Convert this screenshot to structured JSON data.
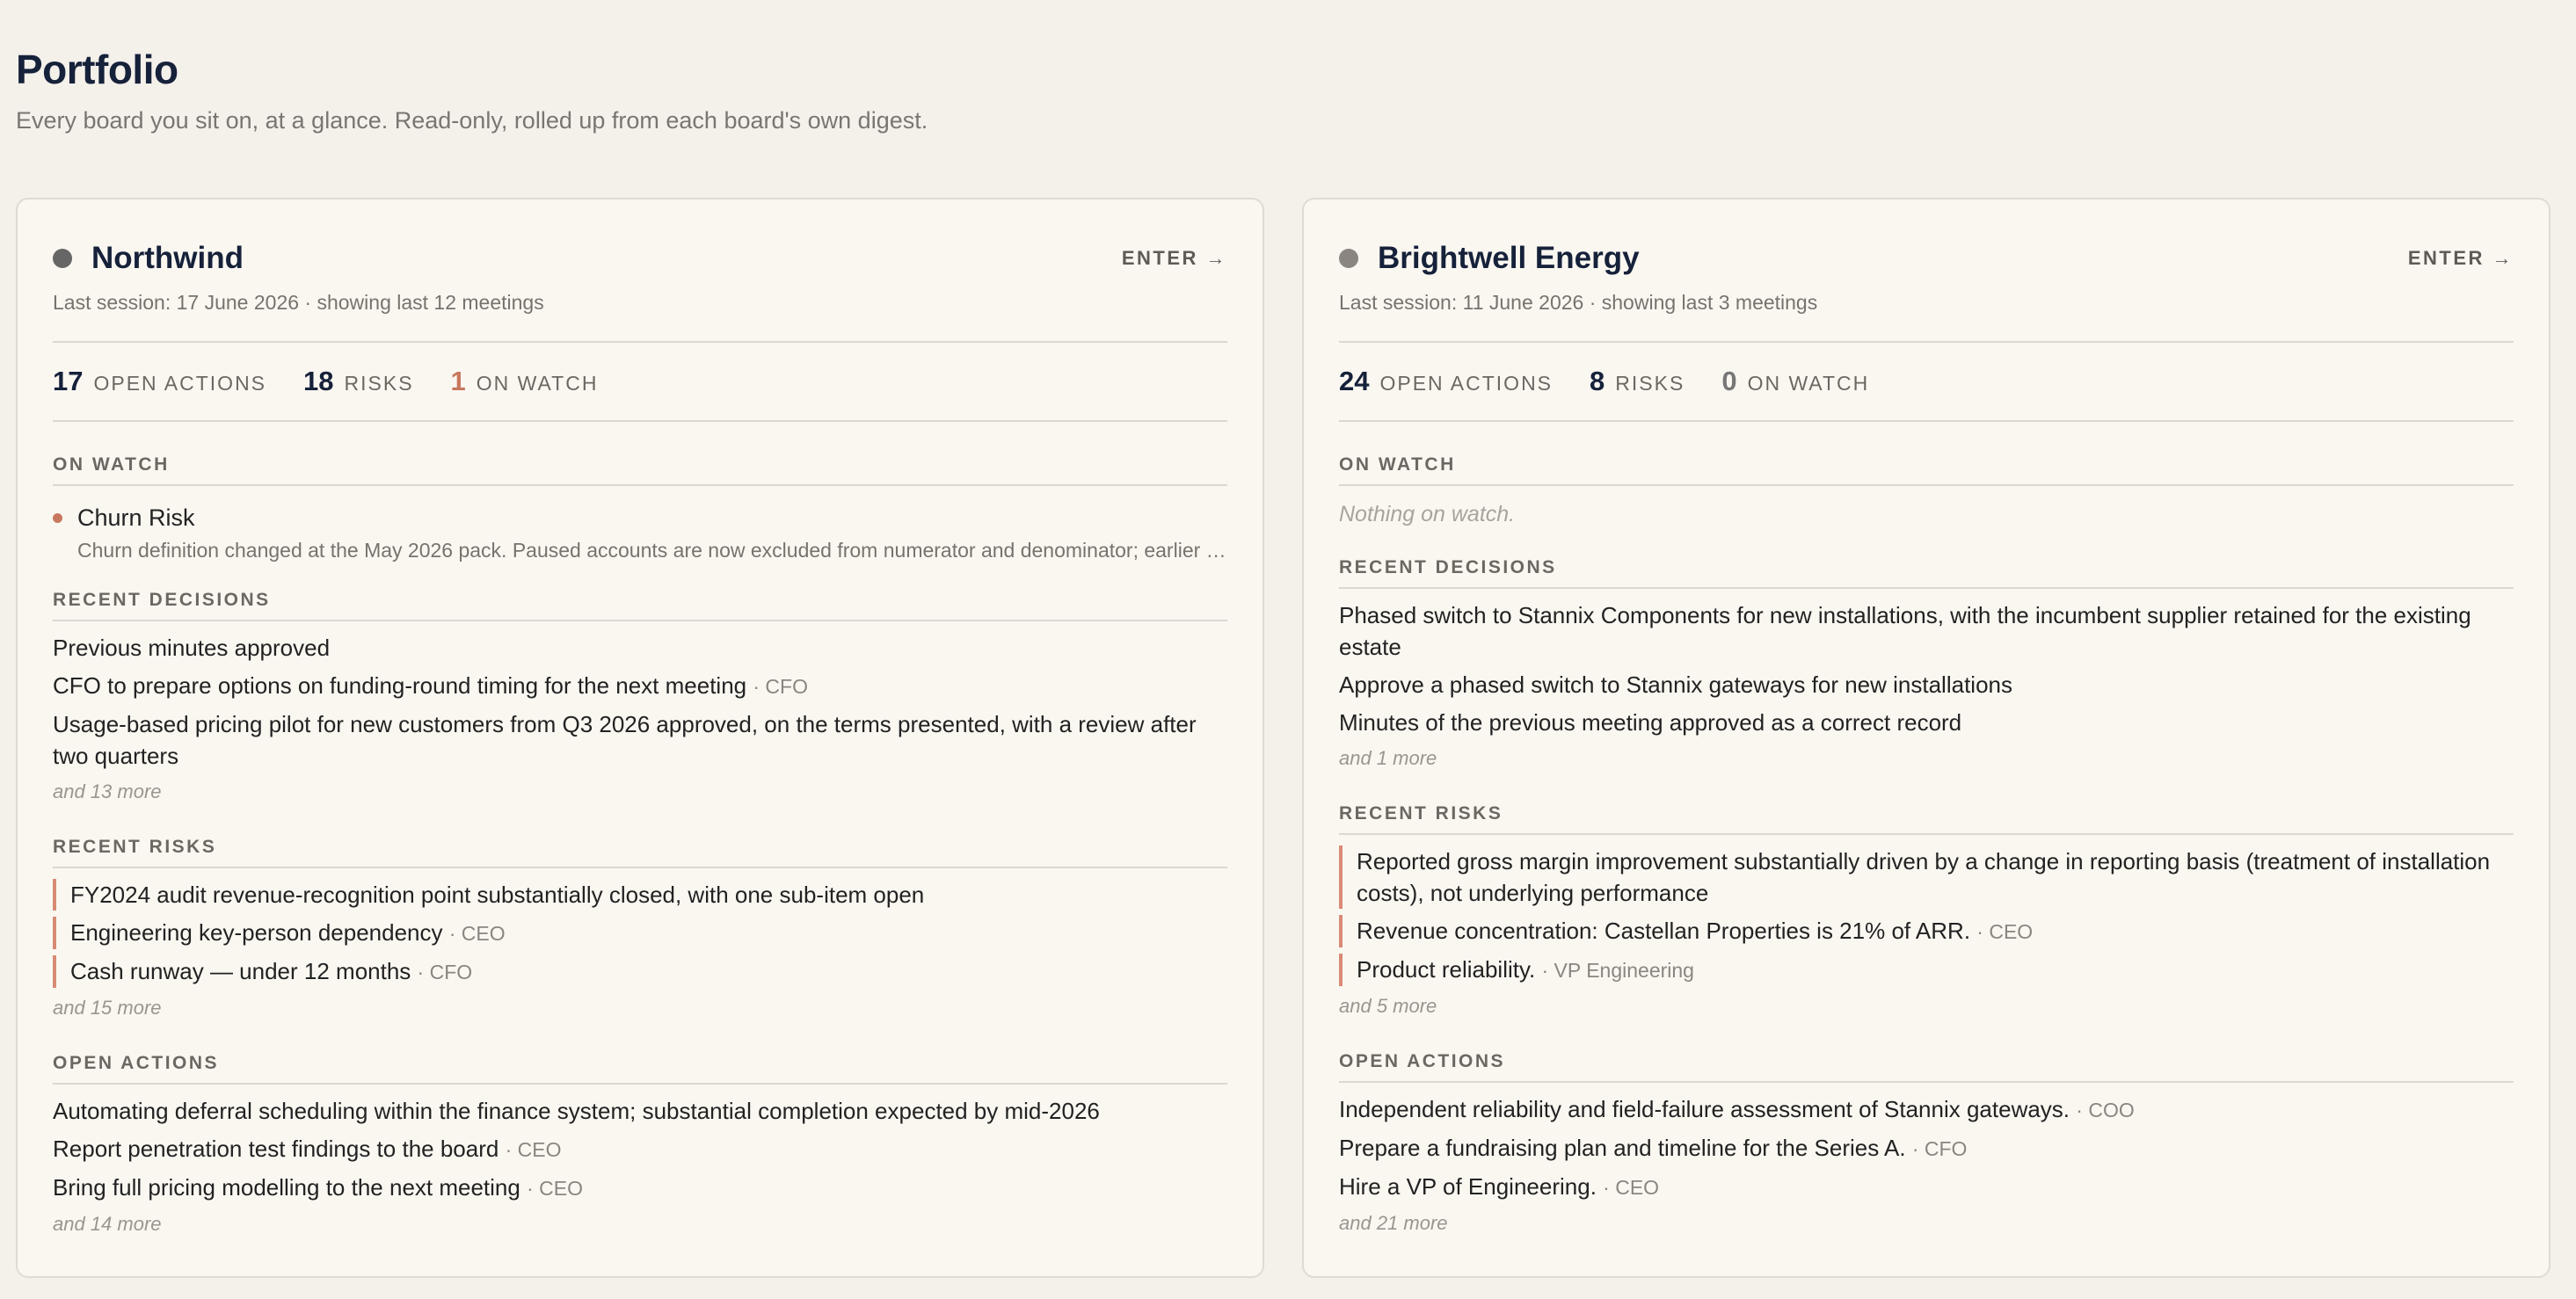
{
  "page": {
    "title": "Portfolio",
    "subtitle": "Every board you sit on, at a glance. Read-only, rolled up from each board's own digest."
  },
  "colors": {
    "accent": "#c8785e",
    "ink": "#16213a",
    "background": "#f4f0ea",
    "card": "#faf7f1"
  },
  "cards": [
    {
      "name": "Northwind",
      "status_color": "#666666",
      "enter_label": "ENTER →",
      "last_session": "Last session: 17 June 2026 · showing last 12 meetings",
      "stats": {
        "open_actions": "17",
        "open_actions_label": "OPEN ACTIONS",
        "risks": "18",
        "risks_label": "RISKS",
        "on_watch": "1",
        "on_watch_label": "ON WATCH"
      },
      "on_watch": {
        "label": "ON WATCH",
        "empty_text": "",
        "items": [
          {
            "title": "Churn Risk",
            "description": "Churn definition changed at the May 2026 pack. Paused accounts are now excluded from numerator and denominator; earlier periods are not restated."
          }
        ]
      },
      "recent_decisions": {
        "label": "RECENT DECISIONS",
        "items": [
          {
            "text": "Previous minutes approved",
            "owner": ""
          },
          {
            "text": "CFO to prepare options on funding-round timing for the next meeting",
            "owner": "· CFO"
          },
          {
            "text": "Usage-based pricing pilot for new customers from Q3 2026 approved, on the terms presented, with a review after two quarters",
            "owner": ""
          }
        ],
        "more": "and 13 more"
      },
      "recent_risks": {
        "label": "RECENT RISKS",
        "items": [
          {
            "text": "FY2024 audit revenue-recognition point substantially closed, with one sub-item open",
            "owner": ""
          },
          {
            "text": "Engineering key-person dependency",
            "owner": "· CEO"
          },
          {
            "text": "Cash runway — under 12 months",
            "owner": "· CFO"
          }
        ],
        "more": "and 15 more"
      },
      "open_actions": {
        "label": "OPEN ACTIONS",
        "items": [
          {
            "text": "Automating deferral scheduling within the finance system; substantial completion expected by mid-2026",
            "owner": ""
          },
          {
            "text": "Report penetration test findings to the board",
            "owner": "· CEO"
          },
          {
            "text": "Bring full pricing modelling to the next meeting",
            "owner": "· CEO"
          }
        ],
        "more": "and 14 more"
      }
    },
    {
      "name": "Brightwell Energy",
      "status_color": "#8a8580",
      "enter_label": "ENTER →",
      "last_session": "Last session: 11 June 2026 · showing last 3 meetings",
      "stats": {
        "open_actions": "24",
        "open_actions_label": "OPEN ACTIONS",
        "risks": "8",
        "risks_label": "RISKS",
        "on_watch": "0",
        "on_watch_label": "ON WATCH"
      },
      "on_watch": {
        "label": "ON WATCH",
        "empty_text": "Nothing on watch.",
        "items": []
      },
      "recent_decisions": {
        "label": "RECENT DECISIONS",
        "items": [
          {
            "text": "Phased switch to Stannix Components for new installations, with the incumbent supplier retained for the existing estate",
            "owner": ""
          },
          {
            "text": "Approve a phased switch to Stannix gateways for new installations",
            "owner": ""
          },
          {
            "text": "Minutes of the previous meeting approved as a correct record",
            "owner": ""
          }
        ],
        "more": "and 1 more"
      },
      "recent_risks": {
        "label": "RECENT RISKS",
        "items": [
          {
            "text": "Reported gross margin improvement substantially driven by a change in reporting basis (treatment of installation costs), not underlying performance",
            "owner": ""
          },
          {
            "text": "Revenue concentration: Castellan Properties is 21% of ARR.",
            "owner": "· CEO"
          },
          {
            "text": "Product reliability.",
            "owner": "· VP Engineering"
          }
        ],
        "more": "and 5 more"
      },
      "open_actions": {
        "label": "OPEN ACTIONS",
        "items": [
          {
            "text": "Independent reliability and field-failure assessment of Stannix gateways.",
            "owner": "· COO"
          },
          {
            "text": "Prepare a fundraising plan and timeline for the Series A.",
            "owner": "· CFO"
          },
          {
            "text": "Hire a VP of Engineering.",
            "owner": "· CEO"
          }
        ],
        "more": "and 21 more"
      }
    }
  ]
}
